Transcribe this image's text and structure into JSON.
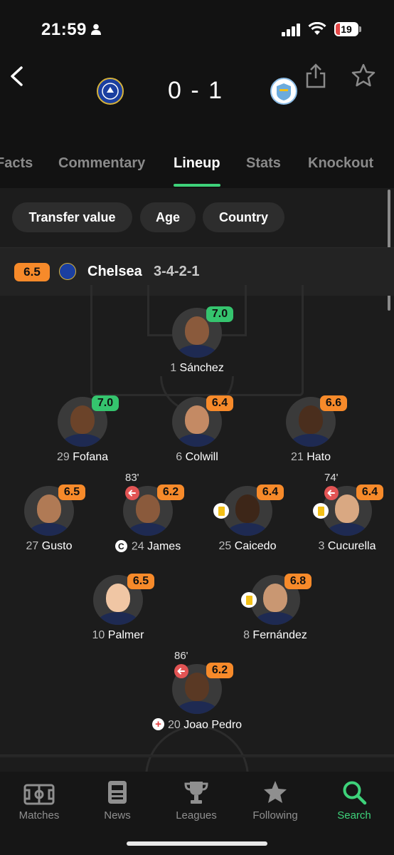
{
  "status_bar": {
    "time": "21:59",
    "battery": "19"
  },
  "match": {
    "score": "0 - 1",
    "home_team": "Chelsea",
    "away_team": "Manchester City"
  },
  "tabs": [
    "Facts",
    "Commentary",
    "Lineup",
    "Stats",
    "Knockout"
  ],
  "active_tab": "Lineup",
  "filters": [
    "Transfer value",
    "Age",
    "Country"
  ],
  "team": {
    "rating": "6.5",
    "name": "Chelsea",
    "formation": "3-4-2-1"
  },
  "players": [
    {
      "number": "1",
      "name": "Sánchez",
      "rating": "7.0",
      "rating_color": "green"
    },
    {
      "number": "29",
      "name": "Fofana",
      "rating": "7.0",
      "rating_color": "green"
    },
    {
      "number": "6",
      "name": "Colwill",
      "rating": "6.4",
      "rating_color": "orange"
    },
    {
      "number": "21",
      "name": "Hato",
      "rating": "6.6",
      "rating_color": "orange"
    },
    {
      "number": "27",
      "name": "Gusto",
      "rating": "6.5",
      "rating_color": "orange"
    },
    {
      "number": "24",
      "name": "James",
      "rating": "6.2",
      "rating_color": "orange",
      "sub_minute": "83'",
      "captain": "C"
    },
    {
      "number": "25",
      "name": "Caicedo",
      "rating": "6.4",
      "rating_color": "orange",
      "yellow_card": true
    },
    {
      "number": "3",
      "name": "Cucurella",
      "rating": "6.4",
      "rating_color": "orange",
      "sub_minute": "74'",
      "yellow_card": true
    },
    {
      "number": "10",
      "name": "Palmer",
      "rating": "6.5",
      "rating_color": "orange"
    },
    {
      "number": "8",
      "name": "Fernández",
      "rating": "6.8",
      "rating_color": "orange",
      "yellow_card": true
    },
    {
      "number": "20",
      "name": "Joao Pedro",
      "rating": "6.2",
      "rating_color": "orange",
      "sub_minute": "86'",
      "injury": true
    }
  ],
  "bottom_nav": [
    "Matches",
    "News",
    "Leagues",
    "Following",
    "Search"
  ],
  "active_nav": "Search",
  "colors": {
    "accent": "#3ed27a",
    "rating_green": "#35c46e",
    "rating_orange": "#f78a2a",
    "sub_red": "#e25454",
    "yellow_card": "#f3c018"
  }
}
